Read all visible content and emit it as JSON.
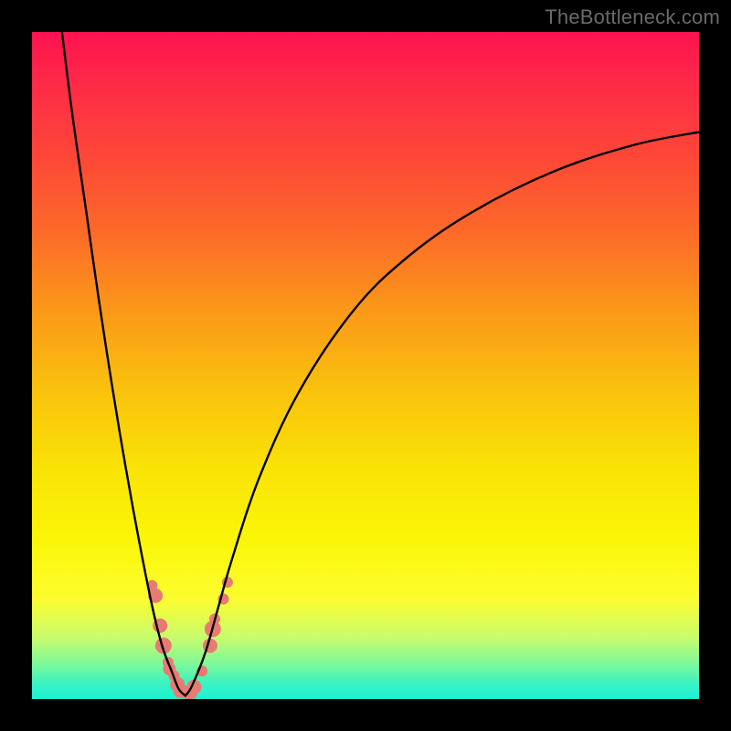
{
  "watermark": "TheBottleneck.com",
  "domain": "Chart",
  "chart_data": {
    "type": "line",
    "title": "",
    "xlabel": "",
    "ylabel": "",
    "xlim": [
      0,
      100
    ],
    "ylim": [
      0,
      100
    ],
    "grid": false,
    "legend": false,
    "note": "V-shaped bottleneck curve on red-to-green vertical gradient; values are estimated from pixel positions (no axis ticks shown).",
    "series": [
      {
        "name": "left-branch",
        "x": [
          4.5,
          6,
          8,
          10,
          12,
          14,
          16,
          18,
          19.5,
          21,
          22,
          23
        ],
        "y": [
          100,
          88,
          74,
          60,
          47,
          35,
          24,
          14,
          8,
          4,
          1.5,
          0.5
        ]
      },
      {
        "name": "right-branch",
        "x": [
          23,
          24,
          26,
          28,
          30,
          34,
          40,
          48,
          56,
          66,
          78,
          90,
          100
        ],
        "y": [
          0.5,
          2,
          7,
          14,
          21,
          33,
          46,
          58,
          66,
          73,
          79,
          83,
          85
        ]
      }
    ],
    "markers": {
      "name": "highlighted-points",
      "color": "#e77b74",
      "points": [
        {
          "x": 18.0,
          "y": 17.0,
          "r": 6
        },
        {
          "x": 18.5,
          "y": 15.5,
          "r": 8
        },
        {
          "x": 19.2,
          "y": 11.0,
          "r": 8
        },
        {
          "x": 19.7,
          "y": 8.0,
          "r": 9
        },
        {
          "x": 20.4,
          "y": 5.5,
          "r": 6
        },
        {
          "x": 20.6,
          "y": 4.5,
          "r": 7
        },
        {
          "x": 21.3,
          "y": 3.5,
          "r": 6
        },
        {
          "x": 21.8,
          "y": 2.2,
          "r": 8
        },
        {
          "x": 22.3,
          "y": 1.2,
          "r": 8
        },
        {
          "x": 23.2,
          "y": 0.8,
          "r": 6
        },
        {
          "x": 23.7,
          "y": 1.0,
          "r": 8
        },
        {
          "x": 24.3,
          "y": 1.8,
          "r": 8
        },
        {
          "x": 25.5,
          "y": 4.2,
          "r": 6
        },
        {
          "x": 26.7,
          "y": 8.0,
          "r": 8
        },
        {
          "x": 27.1,
          "y": 10.5,
          "r": 9
        },
        {
          "x": 27.4,
          "y": 12.0,
          "r": 6
        },
        {
          "x": 28.7,
          "y": 15.0,
          "r": 6
        },
        {
          "x": 29.3,
          "y": 17.5,
          "r": 6
        }
      ]
    }
  }
}
